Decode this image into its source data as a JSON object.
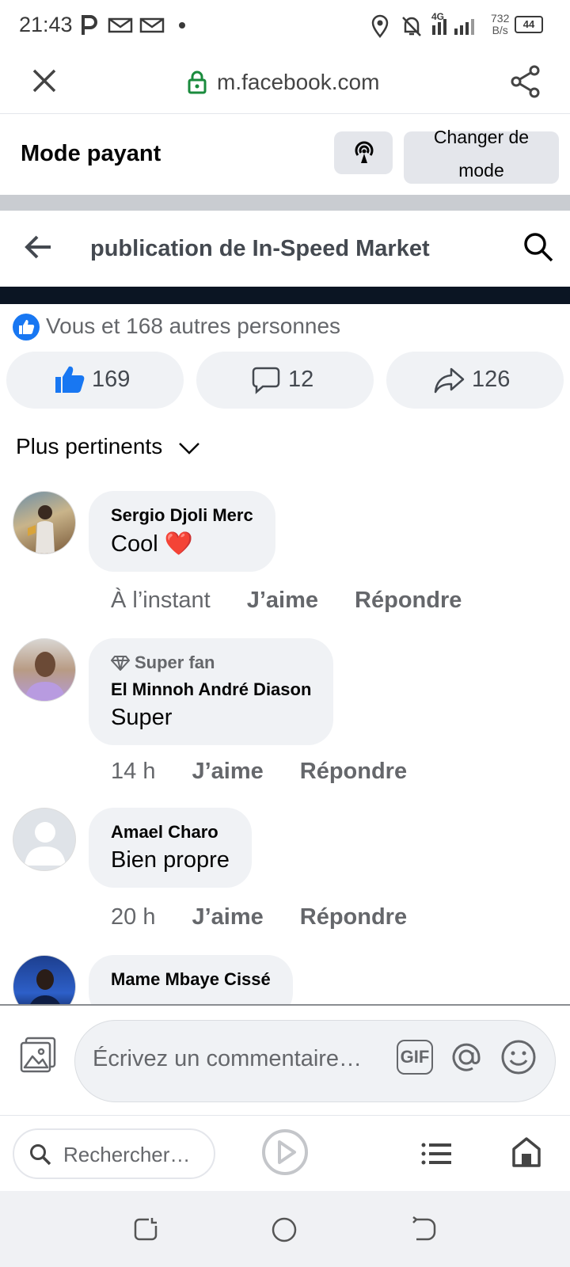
{
  "status_bar": {
    "time": "21:43",
    "network": "4G",
    "speed_value": "732",
    "speed_unit": "B/s",
    "battery": "44",
    "icons": [
      "parking-icon",
      "mail-icon",
      "mail-icon",
      "dot-icon",
      "location-icon",
      "mute-bell-icon",
      "signal-icon",
      "battery-icon"
    ]
  },
  "browser": {
    "url": "m.facebook.com",
    "close_icon": "close-icon",
    "share_icon": "share-icon",
    "lock_color": "#1a8b3d"
  },
  "mode_bar": {
    "title": "Mode payant",
    "change_button_line1": "Changer de",
    "change_button_line2": "mode"
  },
  "header": {
    "title": "publication de In-Speed Market"
  },
  "reactions": {
    "summary": "Vous et 168 autres personnes",
    "likes": "169",
    "comments": "12",
    "shares": "126",
    "like_color": "#1877f2"
  },
  "sort": {
    "label": "Plus pertinents"
  },
  "comments": [
    {
      "name": "Sergio Djoli Merc",
      "text": "Cool",
      "emoji": "❤️",
      "time": "À l’instant",
      "like": "J’aime",
      "reply": "Répondre"
    },
    {
      "badge": "Super fan",
      "name": "El Minnoh André Diason",
      "text": "Super",
      "time": "14 h",
      "like": "J’aime",
      "reply": "Répondre"
    },
    {
      "name": "Amael Charo",
      "text": "Bien propre",
      "time": "20 h",
      "like": "J’aime",
      "reply": "Répondre"
    },
    {
      "name": "Mame Mbaye Cissé"
    }
  ],
  "composer": {
    "placeholder": "Écrivez un commentaire…",
    "gif_label": "GIF"
  },
  "bottom_nav": {
    "search_placeholder": "Rechercher…"
  }
}
